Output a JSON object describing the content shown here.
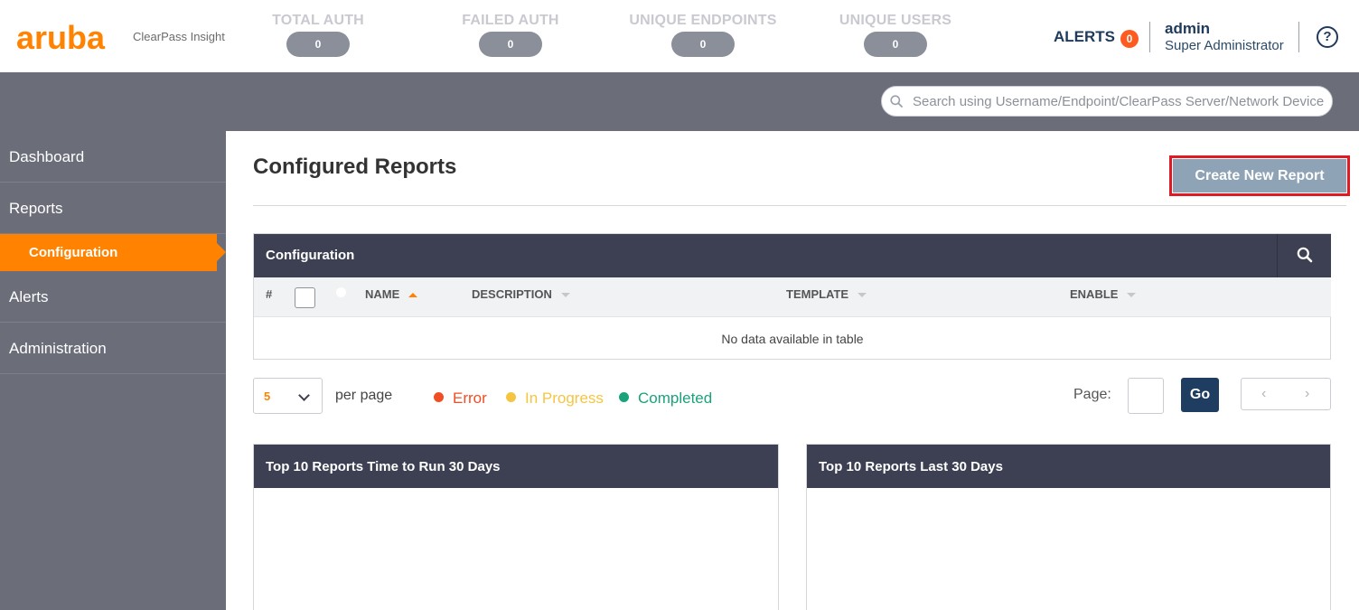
{
  "header": {
    "logo": "aruba",
    "product": "ClearPass Insight",
    "stats": [
      {
        "label": "TOTAL AUTH",
        "value": "0"
      },
      {
        "label": "FAILED AUTH",
        "value": "0"
      },
      {
        "label": "UNIQUE ENDPOINTS",
        "value": "0"
      },
      {
        "label": "UNIQUE USERS",
        "value": "0"
      }
    ],
    "alerts_label": "ALERTS",
    "alerts_count": "0",
    "user_name": "admin",
    "user_role": "Super Administrator",
    "help_glyph": "?"
  },
  "search": {
    "placeholder": "Search using Username/Endpoint/ClearPass Server/Network Device"
  },
  "sidebar": {
    "items": [
      {
        "label": "Dashboard"
      },
      {
        "label": "Reports"
      },
      {
        "label": "Configuration"
      },
      {
        "label": "Alerts"
      },
      {
        "label": "Administration"
      }
    ]
  },
  "main": {
    "title": "Configured Reports",
    "create_button": "Create New Report",
    "table": {
      "title": "Configuration",
      "columns": [
        "#",
        "NAME",
        "DESCRIPTION",
        "TEMPLATE",
        "ENABLE"
      ],
      "empty_text": "No data available in table"
    },
    "per_page_value": "5",
    "per_page_label": "per page",
    "legend": [
      {
        "label": "Error",
        "color": "#f04e23"
      },
      {
        "label": "In Progress",
        "color": "#f5c542"
      },
      {
        "label": "Completed",
        "color": "#1aa37a"
      }
    ],
    "page_label": "Page:",
    "go_button": "Go",
    "prev_glyph": "‹",
    "next_glyph": "›",
    "panels": [
      {
        "title": "Top 10 Reports Time to Run 30 Days"
      },
      {
        "title": "Top 10 Reports Last 30 Days"
      }
    ]
  },
  "colors": {
    "brand": "#ff8300",
    "nav_bg": "#6b6e79",
    "table_header_bg": "#3d4053",
    "go_button_bg": "#1f3d60",
    "highlight": "#e01a22"
  }
}
